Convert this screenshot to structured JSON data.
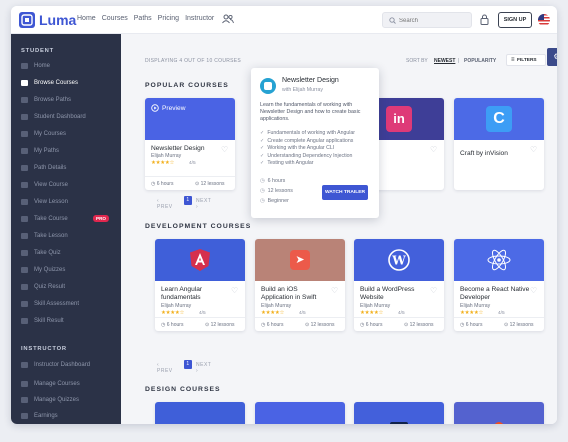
{
  "app": {
    "brand": "Luma"
  },
  "nav": {
    "items": [
      "Home",
      "Courses",
      "Paths",
      "Pricing",
      "Instructor"
    ]
  },
  "search": {
    "placeholder": "Search"
  },
  "header": {
    "signup": "SIGN UP"
  },
  "sidebar": {
    "student_heading": "STUDENT",
    "student_items": [
      "Home",
      "Browse Courses",
      "Browse Paths",
      "Student Dashboard",
      "My Courses",
      "My Paths",
      "Path Details",
      "View Course",
      "View Lesson",
      "Take Course",
      "Take Lesson",
      "Take Quiz",
      "My Quizzes",
      "Quiz Result",
      "Skill Assessment",
      "Skill Result"
    ],
    "active_item": "Browse Courses",
    "pro_badge": "PRO",
    "instructor_heading": "INSTRUCTOR",
    "instructor_items": [
      "Instructor Dashboard",
      "Manage Courses",
      "Manage Quizzes",
      "Earnings"
    ]
  },
  "toolbar": {
    "displaying": "DISPLAYING 4 OUT OF 10 COURSES",
    "sort_by": "SORT BY",
    "newest": "NEWEST",
    "separator": "|",
    "popularity": "POPULARITY",
    "filters": "FILTERS"
  },
  "sections": {
    "popular": "POPULAR COURSES",
    "development": "DEVELOPMENT COURSES",
    "design": "DESIGN COURSES"
  },
  "popular_cards": [
    {
      "title": "Newsletter Design",
      "author": "Elijah Murray",
      "stars": "★★★★☆",
      "rating": "4/5",
      "hours": "6 hours",
      "lessons": "12 lessons",
      "preview": "Preview"
    },
    {
      "title": "...n App"
    },
    {
      "title": "Craft by inVision"
    }
  ],
  "dev_cards": [
    {
      "title": "Learn Angular fundamentals",
      "author": "Elijah Murray",
      "stars": "★★★★☆",
      "rating": "4/5",
      "hours": "6 hours",
      "lessons": "12 lessons"
    },
    {
      "title": "Build an iOS Application in Swift",
      "author": "Elijah Murray",
      "stars": "★★★★☆",
      "rating": "4/5",
      "hours": "6 hours",
      "lessons": "12 lessons"
    },
    {
      "title": "Build a WordPress Website",
      "author": "Elijah Murray",
      "stars": "★★★★☆",
      "rating": "4/5",
      "hours": "6 hours",
      "lessons": "12 lessons"
    },
    {
      "title": "Become a React Native Developer",
      "author": "Elijah Murray",
      "stars": "★★★★☆",
      "rating": "4/5",
      "hours": "6 hours",
      "lessons": "12 lessons"
    }
  ],
  "pager": {
    "prev": "‹ PREV",
    "page": "1",
    "next": "NEXT ›"
  },
  "popup": {
    "title": "Newsletter Design",
    "author": "with Elijah Murray",
    "description": "Learn the fundamentals of working with Newsletter Design and how to create basic applications.",
    "features": [
      "Fundamentals of working with Angular",
      "Create complete Angular applications",
      "Working with the Angular CLI",
      "Understanding Dependency Injection",
      "Testing with Angular"
    ],
    "hours": "6 hours",
    "lessons": "12 lessons",
    "level": "Beginner",
    "button": "WATCH TRAILER"
  },
  "colors": {
    "accent": "#3e56d3",
    "sidebar": "#2b3247",
    "pro": "#e0274e"
  }
}
